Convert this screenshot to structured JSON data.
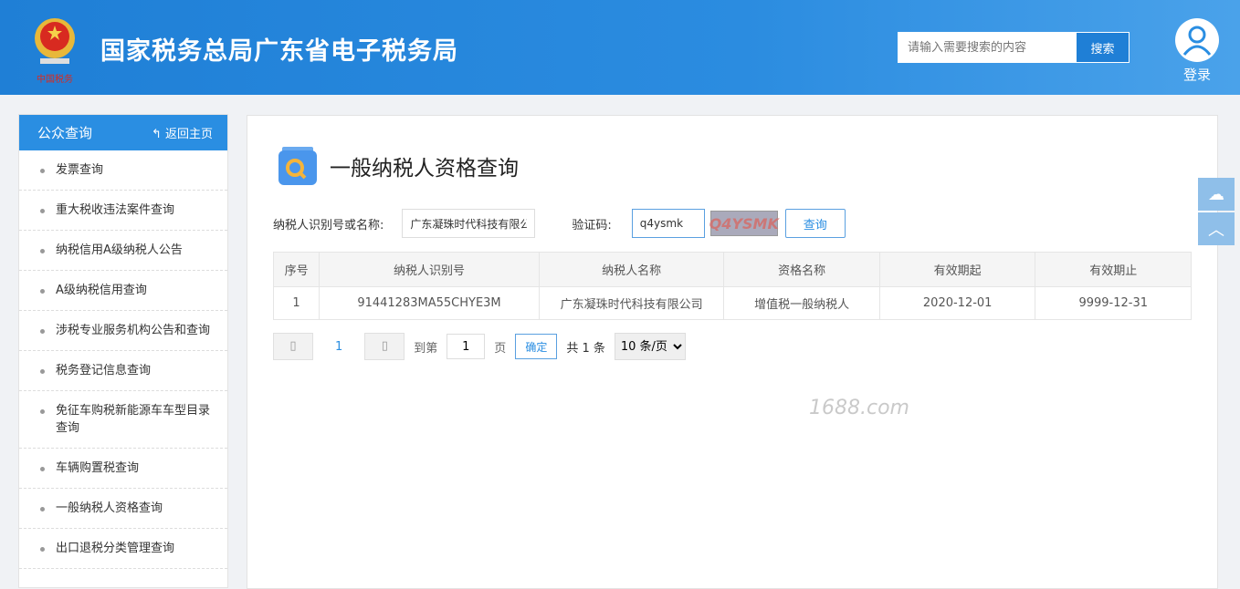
{
  "header": {
    "title": "国家税务总局广东省电子税务局",
    "logo_text": "中国税务",
    "search_placeholder": "请输入需要搜索的内容",
    "search_button": "搜索",
    "login_label": "登录"
  },
  "sidebar": {
    "title": "公众查询",
    "back_label": "返回主页",
    "items": [
      {
        "label": "发票查询"
      },
      {
        "label": "重大税收违法案件查询"
      },
      {
        "label": "纳税信用A级纳税人公告"
      },
      {
        "label": "A级纳税信用查询"
      },
      {
        "label": "涉税专业服务机构公告和查询"
      },
      {
        "label": "税务登记信息查询"
      },
      {
        "label": "免征车购税新能源车车型目录查询"
      },
      {
        "label": "车辆购置税查询"
      },
      {
        "label": "一般纳税人资格查询"
      },
      {
        "label": "出口退税分类管理查询"
      }
    ]
  },
  "main": {
    "title": "一般纳税人资格查询",
    "form": {
      "taxpayer_label": "纳税人识别号或名称:",
      "taxpayer_value": "广东凝珠时代科技有限公",
      "captcha_label": "验证码:",
      "captcha_value": "q4ysmk",
      "captcha_image_text": "Q4YSMK",
      "query_button": "查询"
    },
    "table": {
      "headers": [
        "序号",
        "纳税人识别号",
        "纳税人名称",
        "资格名称",
        "有效期起",
        "有效期止"
      ],
      "rows": [
        [
          "1",
          "91441283MA55CHYE3M",
          "广东凝珠时代科技有限公司",
          "增值税一般纳税人",
          "2020-12-01",
          "9999-12-31"
        ]
      ]
    },
    "pager": {
      "prev": "▯",
      "current_page": "1",
      "next": "▯",
      "goto_label": "到第",
      "goto_value": "1",
      "page_unit": "页",
      "confirm": "确定",
      "total": "共 1 条",
      "page_size": "10 条/页"
    }
  },
  "watermark": "1688.com",
  "colors": {
    "header": "#1f7fd6",
    "accent": "#2a8ee2"
  }
}
